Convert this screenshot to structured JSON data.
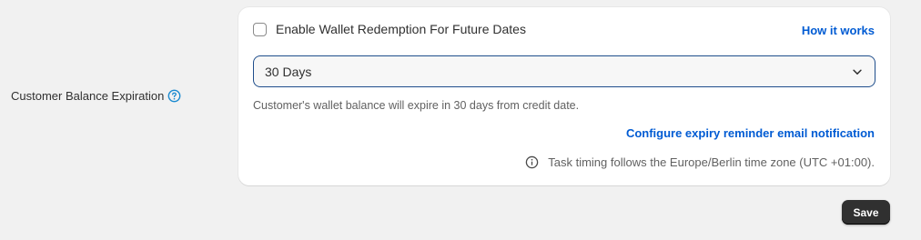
{
  "settings": {
    "field_label": "Customer Balance Expiration",
    "help_icon": "question-circle-icon",
    "wallet_redemption": {
      "label": "Enable Wallet Redemption For Future Dates",
      "checked": false
    },
    "how_it_works_link": "How it works",
    "expiration_select": {
      "selected": "30 Days"
    },
    "help_text": "Customer's wallet balance will expire in 30 days from credit date.",
    "configure_link": "Configure expiry reminder email notification",
    "timing_note": "Task timing follows the Europe/Berlin time zone (UTC +01:00).",
    "save_label": "Save"
  },
  "colors": {
    "link": "#005bd3",
    "select_border": "#1f4e8c",
    "help_icon": "#1a8ad0",
    "save_bg": "#303030",
    "page_bg": "#f1f1f1"
  }
}
